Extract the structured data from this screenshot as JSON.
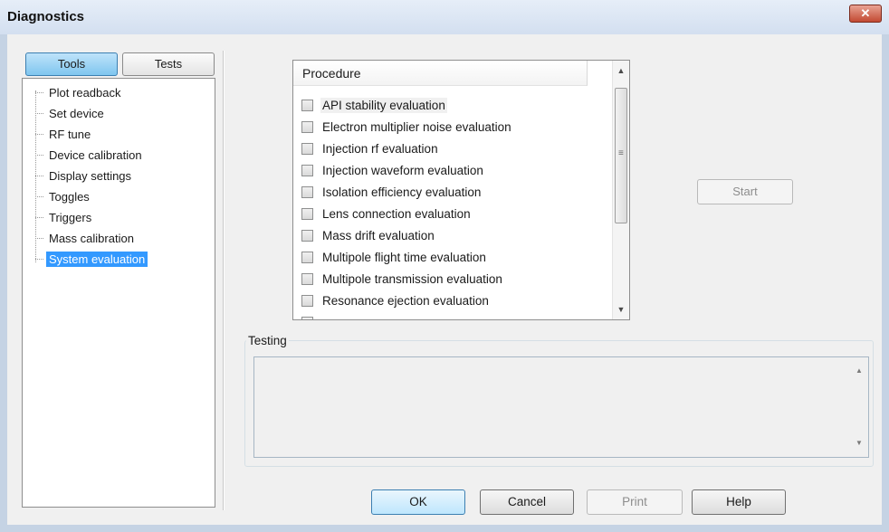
{
  "window": {
    "title": "Diagnostics",
    "close_glyph": "✕",
    "close_icon": "close-icon"
  },
  "tabs": {
    "tools": "Tools",
    "tests": "Tests",
    "active": "Tools"
  },
  "tree": {
    "items": [
      {
        "label": "Plot readback"
      },
      {
        "label": "Set device"
      },
      {
        "label": "RF tune"
      },
      {
        "label": "Device calibration"
      },
      {
        "label": "Display settings"
      },
      {
        "label": "Toggles"
      },
      {
        "label": "Triggers"
      },
      {
        "label": "Mass calibration"
      },
      {
        "label": "System evaluation",
        "selected": true
      }
    ]
  },
  "procedure": {
    "header": "Procedure",
    "items": [
      {
        "label": "API stability evaluation",
        "checked": false
      },
      {
        "label": "Electron multiplier noise evaluation",
        "checked": false
      },
      {
        "label": "Injection rf evaluation",
        "checked": false
      },
      {
        "label": "Injection waveform evaluation",
        "checked": false
      },
      {
        "label": "Isolation efficiency evaluation",
        "checked": false
      },
      {
        "label": "Lens connection evaluation",
        "checked": false
      },
      {
        "label": "Mass drift evaluation",
        "checked": false
      },
      {
        "label": "Multipole flight time evaluation",
        "checked": false
      },
      {
        "label": "Multipole transmission evaluation",
        "checked": false
      },
      {
        "label": "Resonance ejection evaluation",
        "checked": false
      }
    ],
    "scroll_up_glyph": "▲",
    "scroll_down_glyph": "▼",
    "grip_glyph": "≡"
  },
  "start_button": {
    "label": "Start",
    "enabled": false
  },
  "testing": {
    "label": "Testing",
    "content": "",
    "scroll_up_glyph": "▲",
    "scroll_down_glyph": "▼"
  },
  "buttons": {
    "ok": "OK",
    "cancel": "Cancel",
    "print": "Print",
    "help": "Help"
  },
  "colors": {
    "selection": "#3399ff",
    "close_button": "#c24a32",
    "disabled_text": "#8d8d8d"
  }
}
